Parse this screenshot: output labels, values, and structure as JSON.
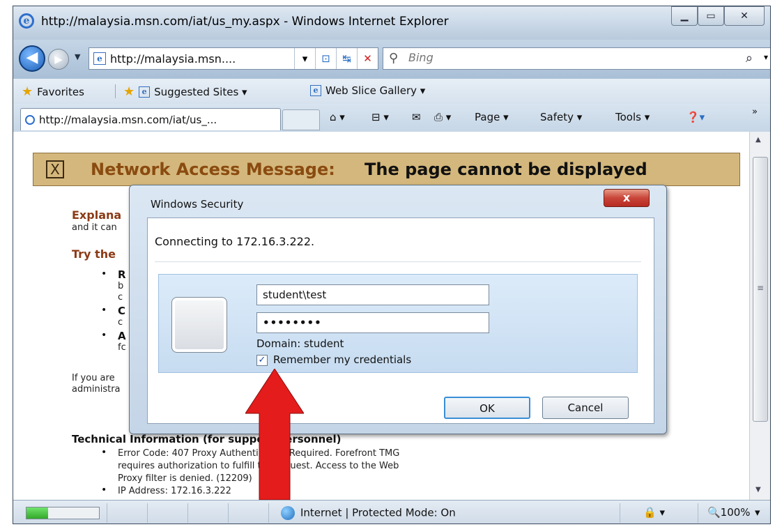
{
  "window": {
    "title": "http://malaysia.msn.com/iat/us_my.aspx - Windows Internet Explorer",
    "minimize": "▁",
    "maximize": "▭",
    "close": "✕"
  },
  "nav": {
    "back_icon": "◀",
    "forward_icon": "▶",
    "address": "http://malaysia.msn....",
    "compat_icon": "⊡",
    "refresh_icon": "↹",
    "stop_icon": "✕",
    "search_placeholder": "Bing",
    "search_go": "⌕",
    "search_icon": "⚲"
  },
  "favorites": {
    "label": "Favorites",
    "suggested": "Suggested Sites ▾",
    "webslice": "Web Slice Gallery ▾"
  },
  "tab": {
    "title": "http://malaysia.msn.com/iat/us_..."
  },
  "commands": {
    "home": "⌂ ▾",
    "feeds": "⊟ ▾",
    "mail": "✉",
    "print": "⎙ ▾",
    "page": "Page ▾",
    "safety": "Safety ▾",
    "tools": "Tools ▾",
    "help": "❓▾",
    "more": "»"
  },
  "content": {
    "banner_x": "X",
    "banner_label": "Network Access Message:",
    "banner_message": "The page cannot be displayed",
    "explanation_head": "Explana",
    "explanation_text": "and it can",
    "try_head": "Try the",
    "b1_head": "R",
    "b1_l2": "b",
    "b1_l3": "c",
    "b2_head": "C",
    "b2_l2": "c",
    "b3_head": "A",
    "b3_l2": "fc",
    "admin_l1": "If you are",
    "admin_l2": "administra",
    "tech_head": "Technical Information (for support personnel)",
    "error_l1": "Error Code: 407 Proxy Authentication Required. Forefront TMG",
    "error_l2": "requires authorization to fulfill the request. Access to the Web",
    "error_l3": "Proxy filter is denied. (12209)",
    "ip": "IP Address: 172.16.3.222",
    "bullet": "•"
  },
  "dialog": {
    "title": "Windows Security",
    "close": "x",
    "message": "Connecting to 172.16.3.222.",
    "username": "student\\test",
    "password": "••••••••",
    "domain": "Domain: student",
    "remember_checked": "✓",
    "remember_label": "Remember my credentials",
    "ok": "OK",
    "cancel": "Cancel"
  },
  "annotation": {
    "arrow_color": "#e41c1c"
  },
  "status": {
    "progress": 0.3,
    "zone": "Internet | Protected Mode: On",
    "security_icon": "🔒 ▾",
    "zoom": "🔍100%",
    "zoom_drop": "▾"
  }
}
